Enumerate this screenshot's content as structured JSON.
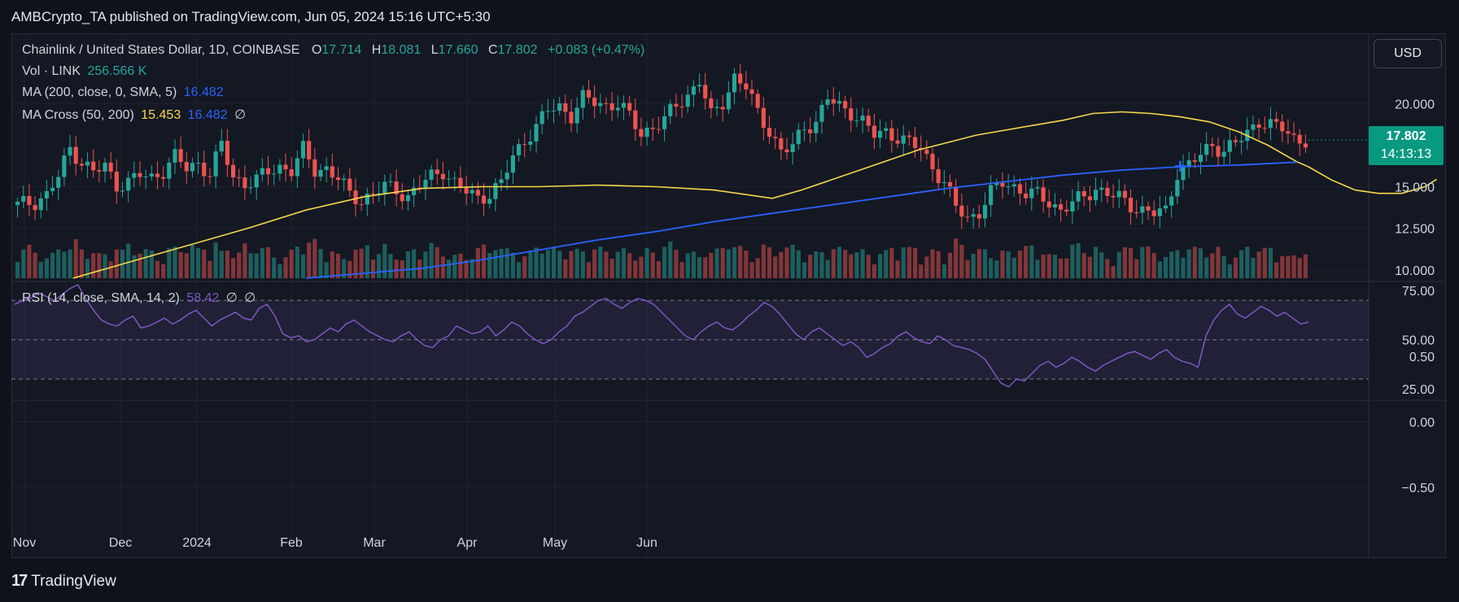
{
  "header": {
    "published_line": "AMBCrypto_TA published on TradingView.com, Jun 05, 2024 15:16 UTC+5:30"
  },
  "legend": {
    "symbol": "Chainlink / United States Dollar, 1D, COINBASE",
    "open_label": "O",
    "open_value": "17.714",
    "high_label": "H",
    "high_value": "18.081",
    "low_label": "L",
    "low_value": "17.660",
    "close_label": "C",
    "close_value": "17.802",
    "change": "+0.083 (+0.47%)",
    "vol_label": "Vol · LINK",
    "vol_value": "256.566 K",
    "ma_label": "MA (200, close, 0, SMA, 5)",
    "ma_value": "16.482",
    "macross_label": "MA Cross (50, 200)",
    "macross_fast": "15.453",
    "macross_slow": "16.482",
    "macross_extra": "∅",
    "rsi_label": "RSI (14, close, SMA, 14, 2)",
    "rsi_value": "58.42",
    "rsi_extra1": "∅",
    "rsi_extra2": "∅"
  },
  "currency_button": "USD",
  "price_tag": {
    "price": "17.802",
    "countdown": "14:13:13"
  },
  "footer": {
    "brand": "TradingView",
    "logo_glyph": "17"
  },
  "colors": {
    "up": "#26a69a",
    "down": "#ef5350",
    "ma200": "#2962ff",
    "ma50": "#f7d84a",
    "rsi": "#7e57c2",
    "tag": "#089981"
  },
  "chart_data": [
    {
      "type": "candlestick",
      "title": "Chainlink / United States Dollar, 1D, COINBASE",
      "x_ticks": [
        "Nov",
        "Dec",
        "2024",
        "Feb",
        "Mar",
        "Apr",
        "May",
        "Jun"
      ],
      "y_ticks": [
        "20.000",
        "17.802",
        "15.000",
        "12.500",
        "10.000"
      ],
      "ylim": [
        9.5,
        22.8
      ],
      "grid": true,
      "close_path": [
        [
          0,
          13.9
        ],
        [
          3,
          14.1
        ],
        [
          5,
          14.5
        ],
        [
          7,
          15.6
        ],
        [
          9,
          17.3
        ],
        [
          11,
          16.5
        ],
        [
          13,
          15.9
        ],
        [
          15,
          16.2
        ],
        [
          17,
          15.1
        ],
        [
          19,
          15.3
        ],
        [
          21,
          15.7
        ],
        [
          23,
          15.5
        ],
        [
          25,
          16.0
        ],
        [
          27,
          16.8
        ],
        [
          29,
          16.1
        ],
        [
          31,
          16.4
        ],
        [
          33,
          15.8
        ],
        [
          35,
          17.5
        ],
        [
          37,
          15.6
        ],
        [
          39,
          15.2
        ],
        [
          41,
          15.4
        ],
        [
          43,
          15.9
        ],
        [
          45,
          16.2
        ],
        [
          47,
          16.0
        ],
        [
          49,
          17.2
        ],
        [
          51,
          16.0
        ],
        [
          53,
          16.1
        ],
        [
          55,
          15.5
        ],
        [
          57,
          14.5
        ],
        [
          59,
          14.2
        ],
        [
          61,
          14.6
        ],
        [
          63,
          15.0
        ],
        [
          65,
          14.8
        ],
        [
          67,
          14.4
        ],
        [
          69,
          15.1
        ],
        [
          71,
          15.6
        ],
        [
          73,
          16.0
        ],
        [
          75,
          15.2
        ],
        [
          77,
          14.7
        ],
        [
          79,
          14.3
        ],
        [
          81,
          14.6
        ],
        [
          83,
          15.2
        ],
        [
          85,
          16.8
        ],
        [
          87,
          17.8
        ],
        [
          89,
          18.6
        ],
        [
          91,
          19.6
        ],
        [
          93,
          19.8
        ],
        [
          95,
          19.3
        ],
        [
          97,
          20.3
        ],
        [
          99,
          20.1
        ],
        [
          101,
          19.9
        ],
        [
          103,
          20.0
        ],
        [
          105,
          19.2
        ],
        [
          107,
          18.2
        ],
        [
          109,
          18.6
        ],
        [
          111,
          19.0
        ],
        [
          113,
          19.9
        ],
        [
          115,
          20.5
        ],
        [
          117,
          21.4
        ],
        [
          119,
          19.2
        ],
        [
          121,
          20.1
        ],
        [
          123,
          21.6
        ],
        [
          125,
          21.0
        ],
        [
          127,
          19.4
        ],
        [
          129,
          18.4
        ],
        [
          131,
          17.1
        ],
        [
          133,
          17.4
        ],
        [
          135,
          18.6
        ],
        [
          137,
          18.9
        ],
        [
          139,
          20.3
        ],
        [
          141,
          19.8
        ],
        [
          143,
          19.5
        ],
        [
          145,
          18.9
        ],
        [
          147,
          18.1
        ],
        [
          149,
          18.3
        ],
        [
          151,
          18.0
        ],
        [
          153,
          17.6
        ],
        [
          155,
          17.3
        ],
        [
          157,
          16.2
        ],
        [
          159,
          15.2
        ],
        [
          161,
          13.8
        ],
        [
          163,
          13.1
        ],
        [
          165,
          13.5
        ],
        [
          167,
          14.6
        ],
        [
          169,
          15.3
        ],
        [
          171,
          15.0
        ],
        [
          173,
          14.6
        ],
        [
          175,
          14.5
        ],
        [
          177,
          14.1
        ],
        [
          179,
          13.6
        ],
        [
          181,
          14.0
        ],
        [
          183,
          14.4
        ],
        [
          185,
          14.9
        ],
        [
          187,
          14.6
        ],
        [
          189,
          14.3
        ],
        [
          191,
          13.9
        ],
        [
          193,
          13.6
        ],
        [
          195,
          13.4
        ],
        [
          197,
          13.5
        ],
        [
          199,
          15.9
        ],
        [
          201,
          16.3
        ],
        [
          203,
          16.9
        ],
        [
          205,
          17.5
        ],
        [
          207,
          17.2
        ],
        [
          209,
          17.6
        ],
        [
          211,
          18.2
        ],
        [
          213,
          19.0
        ],
        [
          215,
          18.7
        ],
        [
          217,
          18.5
        ],
        [
          219,
          17.9
        ],
        [
          221,
          17.802
        ]
      ],
      "ma50_path": [
        [
          10,
          9.5
        ],
        [
          20,
          10.5
        ],
        [
          30,
          11.5
        ],
        [
          40,
          12.5
        ],
        [
          50,
          13.6
        ],
        [
          60,
          14.4
        ],
        [
          70,
          14.9
        ],
        [
          80,
          15.0
        ],
        [
          90,
          15.0
        ],
        [
          100,
          15.1
        ],
        [
          110,
          15.0
        ],
        [
          120,
          14.8
        ],
        [
          130,
          14.3
        ],
        [
          135,
          14.8
        ],
        [
          145,
          16.0
        ],
        [
          155,
          17.2
        ],
        [
          165,
          18.1
        ],
        [
          175,
          18.7
        ],
        [
          180,
          19.0
        ],
        [
          185,
          19.4
        ],
        [
          190,
          19.5
        ],
        [
          195,
          19.4
        ],
        [
          200,
          19.2
        ],
        [
          205,
          18.9
        ],
        [
          210,
          18.3
        ],
        [
          215,
          17.5
        ],
        [
          220,
          16.5
        ],
        [
          222,
          16.2
        ],
        [
          226,
          15.4
        ],
        [
          230,
          14.8
        ],
        [
          234,
          14.6
        ],
        [
          238,
          14.6
        ],
        [
          242,
          15.0
        ],
        [
          244,
          15.45
        ]
      ],
      "ma200_path": [
        [
          50,
          9.5
        ],
        [
          60,
          9.8
        ],
        [
          70,
          10.1
        ],
        [
          80,
          10.6
        ],
        [
          90,
          11.2
        ],
        [
          100,
          11.8
        ],
        [
          110,
          12.3
        ],
        [
          120,
          12.9
        ],
        [
          130,
          13.4
        ],
        [
          140,
          13.9
        ],
        [
          150,
          14.4
        ],
        [
          160,
          14.9
        ],
        [
          170,
          15.3
        ],
        [
          180,
          15.7
        ],
        [
          190,
          16.0
        ],
        [
          200,
          16.2
        ],
        [
          210,
          16.3
        ],
        [
          220,
          16.48
        ]
      ],
      "golden_cross_marker": "+"
    },
    {
      "type": "line",
      "title": "RSI (14, close, SMA, 14, 2)",
      "y_ticks": [
        "75.00",
        "50.00",
        "25.00"
      ],
      "ylim": [
        20,
        78
      ],
      "bands": [
        70,
        50,
        30
      ],
      "values": [
        68,
        70,
        71,
        74,
        72,
        70,
        73,
        76,
        78,
        71,
        65,
        60,
        58,
        57,
        60,
        62,
        56,
        57,
        59,
        61,
        58,
        60,
        63,
        65,
        61,
        57,
        60,
        62,
        64,
        61,
        60,
        66,
        68,
        62,
        53,
        51,
        52,
        49,
        50,
        53,
        56,
        54,
        58,
        60,
        57,
        54,
        52,
        50,
        49,
        52,
        54,
        50,
        47,
        46,
        50,
        52,
        57,
        55,
        53,
        54,
        57,
        52,
        55,
        59,
        57,
        53,
        50,
        48,
        50,
        54,
        57,
        62,
        64,
        67,
        70,
        71,
        68,
        66,
        69,
        71,
        70,
        68,
        64,
        60,
        56,
        52,
        50,
        54,
        57,
        59,
        56,
        55,
        58,
        62,
        65,
        69,
        67,
        63,
        58,
        53,
        50,
        54,
        56,
        53,
        50,
        47,
        49,
        46,
        41,
        43,
        46,
        48,
        52,
        54,
        51,
        49,
        48,
        52,
        50,
        47,
        46,
        45,
        43,
        40,
        34,
        28,
        26,
        30,
        29,
        33,
        37,
        39,
        36,
        38,
        41,
        39,
        36,
        34,
        37,
        39,
        41,
        43,
        44,
        42,
        40,
        43,
        45,
        41,
        39,
        38,
        36,
        52,
        60,
        65,
        68,
        63,
        61,
        64,
        67,
        65,
        62,
        64,
        61,
        58,
        59
      ]
    },
    {
      "type": "line",
      "title": "",
      "y_ticks": [
        "0.50",
        "0.00",
        "−0.50"
      ],
      "ylim": [
        -0.6,
        0.6
      ],
      "values": []
    }
  ]
}
